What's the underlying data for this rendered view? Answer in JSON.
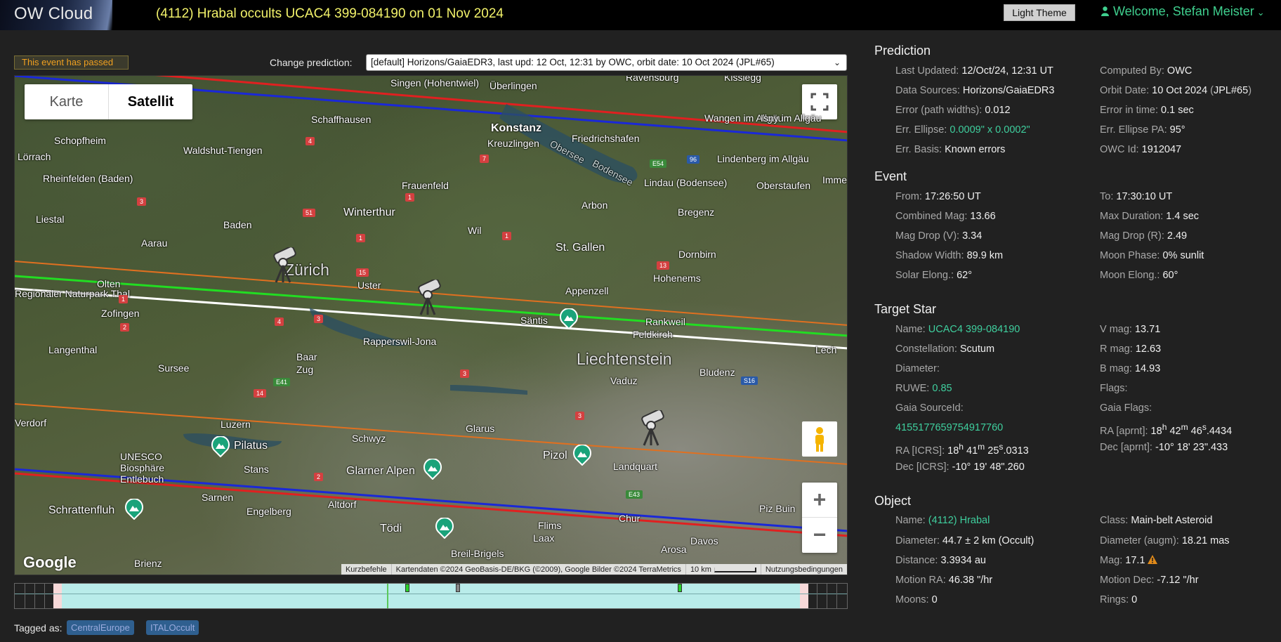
{
  "header": {
    "brand": "OW Cloud",
    "event_title": "(4112) Hrabal occults UCAC4 399-084190 on 01 Nov 2024",
    "theme_button": "Light Theme",
    "welcome": "Welcome, Stefan Meister",
    "accent_color": "#3fcf8e",
    "title_color": "#f2f26a"
  },
  "toolbar": {
    "passed_notice": "This event has passed",
    "change_label": "Change prediction:",
    "prediction_selected": "[default] Horizons/GaiaEDR3, last upd: 12 Oct, 12:31 by OWC, orbit date: 10 Oct 2024 (JPL#65)"
  },
  "map": {
    "maptype": {
      "map": "Karte",
      "satellite": "Satellit"
    },
    "google": "Google",
    "attribution": {
      "shortcuts": "Kurzbefehle",
      "data": "Kartendaten ©2024 GeoBasis-DE/BKG (©2009), Google Bilder ©2024 TerraMetrics",
      "scale": "10 km",
      "terms": "Nutzungsbedingungen"
    },
    "places": [
      "Singen (Hohentwiel)",
      "Überlingen",
      "Ravensburg",
      "Kisslegg",
      "Schaffhausen",
      "Konstanz",
      "Friedrichshafen",
      "Wangen im Allgäu",
      "Isny im Allgäu",
      "Kreuzlingen",
      "Bodensee",
      "Obersee",
      "Schopfheim",
      "Waldshut-Tiengen",
      "Lörrach",
      "Lindenberg im Allgäu",
      "Rheinfelden (Baden)",
      "Frauenfeld",
      "Lindau (Bodensee)",
      "Oberstaufen",
      "Immenstadt",
      "Arbon",
      "Liestal",
      "Winterthur",
      "Bregenz",
      "Baden",
      "Wil",
      "St. Gallen",
      "Aarau",
      "Zürich",
      "Dornbirn",
      "Uster",
      "Hohenems",
      "Olten",
      "Appenzell",
      "Regionaler Naturpark Thal",
      "Zofingen",
      "Säntis",
      "Rankweil",
      "Feldkirch",
      "Rapperswil-Jona",
      "Langenthal",
      "Liechtenstein",
      "Baar",
      "Zug",
      "Sursee",
      "Vaduz",
      "Bludenz",
      "Luzern",
      "Glarus",
      "Pilatus",
      "Schwyz",
      "Pizol",
      "UNESCO Biosphäre Entlebuch",
      "Stans",
      "Glarner Alpen",
      "Landquart",
      "Sarnen",
      "Schrattenfluh",
      "Altdorf",
      "Chur",
      "Piz Buin",
      "Engelberg",
      "Tödi",
      "Flims",
      "Laax",
      "Davos",
      "Brienz",
      "Breil-Brigels",
      "Arosa",
      "Lech",
      "Verdorf"
    ],
    "telescopes": [
      "Zürich observer",
      "Rapperswil observer",
      "Landquart observer"
    ],
    "path_colors": {
      "center": "#ffffff",
      "shadow": "#22dd22",
      "error": "#e07020",
      "limit_blue": "#1a28d8",
      "limit_red": "#e02020"
    }
  },
  "timeline": {},
  "tags": {
    "label": "Tagged as:",
    "items": [
      "CentralEurope",
      "ITALOccult"
    ]
  },
  "prediction": {
    "title": "Prediction",
    "last_updated_k": "Last Updated:",
    "last_updated_v": "12/Oct/24, 12:31 UT",
    "computed_by_k": "Computed By:",
    "computed_by_v": "OWC",
    "data_sources_k": "Data Sources:",
    "data_sources_v": "Horizons/GaiaEDR3",
    "orbit_date_k": "Orbit Date:",
    "orbit_date_v": "10 Oct 2024",
    "orbit_paren_open": " (",
    "orbit_ref": "JPL#65",
    "orbit_paren_close": ")",
    "error_path_k": "Error (path widths):",
    "error_path_v": "0.012",
    "error_time_k": "Error in time:",
    "error_time_v": "0.1 sec",
    "err_ellipse_k": "Err. Ellipse:",
    "err_ellipse_v": "0.0009\" x 0.0002\"",
    "err_ellipse_pa_k": "Err. Ellipse PA:",
    "err_ellipse_pa_v": "95°",
    "err_basis_k": "Err. Basis:",
    "err_basis_v": "Known errors",
    "owc_id_k": "OWC Id:",
    "owc_id_v": "1912047"
  },
  "event": {
    "title": "Event",
    "from_k": "From:",
    "from_v": "17:26:50 UT",
    "to_k": "To:",
    "to_v": "17:30:10 UT",
    "combined_mag_k": "Combined Mag:",
    "combined_mag_v": "13.66",
    "max_duration_k": "Max Duration:",
    "max_duration_v": "1.4 sec",
    "mag_drop_v_k": "Mag Drop (V):",
    "mag_drop_v_v": "3.34",
    "mag_drop_r_k": "Mag Drop (R):",
    "mag_drop_r_v": "2.49",
    "shadow_width_k": "Shadow Width:",
    "shadow_width_v": "89.9 km",
    "moon_phase_k": "Moon Phase:",
    "moon_phase_v": "0% sunlit",
    "solar_elong_k": "Solar Elong.:",
    "solar_elong_v": "62°",
    "moon_elong_k": "Moon Elong.:",
    "moon_elong_v": "60°"
  },
  "target_star": {
    "title": "Target Star",
    "name_k": "Name:",
    "name_v": "UCAC4 399-084190",
    "vmag_k": "V mag:",
    "vmag_v": "13.71",
    "constellation_k": "Constellation:",
    "constellation_v": "Scutum",
    "rmag_k": "R mag:",
    "rmag_v": "12.63",
    "diameter_k": "Diameter:",
    "bmag_k": "B mag:",
    "bmag_v": "14.93",
    "ruwe_k": "RUWE:",
    "ruwe_v": "0.85",
    "flags_k": "Flags:",
    "gaia_source_k": "Gaia SourceId:",
    "gaia_flags_k": "Gaia Flags:",
    "gaia_source_v": "4155177659754917760",
    "ra_aprnt_k": "RA [aprnt]:",
    "ra_aprnt_h": "18",
    "ra_aprnt_m": "42",
    "ra_aprnt_s": "46",
    "ra_aprnt_f": ".4434",
    "ra_icrs_k": "RA [ICRS]:",
    "ra_icrs_h": "18",
    "ra_icrs_m": "41",
    "ra_icrs_s": "25",
    "ra_icrs_f": ".0313",
    "dec_aprnt_k": "Dec [aprnt]:",
    "dec_aprnt_v": "-10° 18' 23\".433",
    "dec_icrs_k": "Dec [ICRS]:",
    "dec_icrs_v": "-10° 19' 48\".260"
  },
  "object": {
    "title": "Object",
    "name_k": "Name:",
    "name_v": "(4112) Hrabal",
    "class_k": "Class:",
    "class_v": "Main-belt Asteroid",
    "diameter_k": "Diameter:",
    "diameter_v": "44.7 ± 2 km",
    "diameter_src": " (Occult)",
    "diameter_augm_k": "Diameter (augm):",
    "diameter_augm_v": "18.21 mas",
    "distance_k": "Distance:",
    "distance_v": "3.3934 au",
    "mag_k": "Mag:",
    "mag_v": "17.1",
    "motion_ra_k": "Motion RA:",
    "motion_ra_v": "46.38 \"/hr",
    "motion_dec_k": "Motion Dec:",
    "motion_dec_v": "-7.12 \"/hr",
    "moons_k": "Moons:",
    "moons_v": "0",
    "rings_k": "Rings:",
    "rings_v": "0"
  }
}
